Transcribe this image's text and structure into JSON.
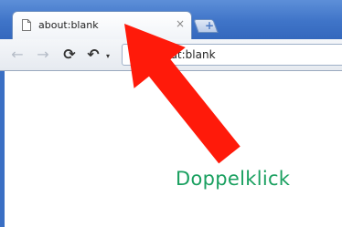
{
  "browser": {
    "tab": {
      "title": "about:blank",
      "close_glyph": "×",
      "icon": "page-icon"
    },
    "newtab_glyph": "+",
    "toolbar": {
      "back_glyph": "←",
      "forward_glyph": "→",
      "reload_glyph": "⟳",
      "undo_glyph": "↶",
      "undo_caret": "▾"
    },
    "omnibox": {
      "value": "about:blank"
    }
  },
  "annotation": {
    "caption": "Doppelklick",
    "caption_color": "#1aa060",
    "arrow_color": "#ff1a0a"
  }
}
